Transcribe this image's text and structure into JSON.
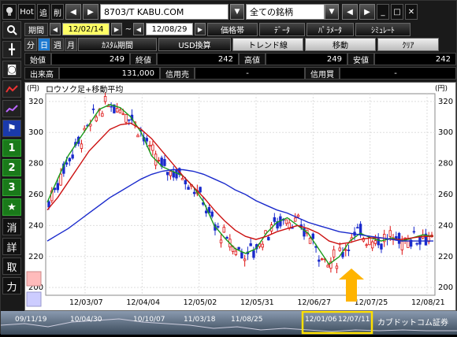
{
  "toolbar": {
    "hot": "Hot",
    "add": "追",
    "delete": "削",
    "symbol": "8703/T KABU.COM",
    "list": "全ての銘柄"
  },
  "period_row": {
    "label": "期間",
    "start": "12/02/14",
    "tilde": "~",
    "end": "12/08/29",
    "buttons": [
      "価格帯",
      "ﾃﾞｰﾀ",
      "ﾊﾟﾗﾒｰﾀ",
      "ｼﾐｭﾚｰﾄ"
    ]
  },
  "row2": {
    "periods": [
      "分",
      "日",
      "週",
      "月"
    ],
    "selected": "日",
    "buttons": [
      "ｶｽﾀﾑ期間",
      "USD換算",
      "トレンド線",
      "移動",
      "ｸﾘｱ"
    ]
  },
  "quote": {
    "open_label": "始値",
    "open": "249",
    "close_label": "終値",
    "close": "242",
    "high_label": "高値",
    "high": "249",
    "low_label": "安値",
    "low": "242",
    "volume_label": "出来高",
    "volume": "131,000",
    "margin_sell_label": "信用売",
    "margin_sell": "-",
    "margin_buy_label": "信用買",
    "margin_buy": "-"
  },
  "left_tools": [
    "1",
    "2",
    "3",
    "★",
    "消",
    "詳",
    "取",
    "力"
  ],
  "chart": {
    "unit_left": "(円)",
    "unit_right": "(円)",
    "title": "ロウソク足+移動平均",
    "y_ticks": [
      320,
      300,
      280,
      260,
      240,
      220,
      200
    ],
    "x_ticks": [
      "12/03/07",
      "12/04/04",
      "12/05/02",
      "12/05/31",
      "12/06/27",
      "12/07/25",
      "12/08/21"
    ]
  },
  "chart_data": {
    "type": "line",
    "ylim": [
      195,
      325
    ],
    "series": [
      {
        "values": [
          255,
          270,
          285,
          295,
          305,
          315,
          318,
          316,
          310,
          300,
          285,
          278,
          275,
          272,
          265,
          255,
          240,
          232,
          225,
          222,
          225,
          235,
          242,
          245,
          240,
          235,
          225,
          215,
          220,
          230,
          235,
          232,
          230,
          232,
          230,
          232,
          234,
          233
        ]
      },
      {
        "values": [
          250,
          258,
          268,
          278,
          288,
          295,
          302,
          305,
          306,
          302,
          296,
          288,
          280,
          272,
          265,
          258,
          250,
          243,
          237,
          233,
          231,
          233,
          236,
          238,
          240,
          238,
          235,
          230,
          228,
          229,
          231,
          232,
          232,
          231,
          231,
          232,
          233,
          233
        ]
      },
      {
        "values": [
          230,
          234,
          238,
          243,
          248,
          253,
          258,
          262,
          266,
          270,
          273,
          275,
          276,
          276,
          275,
          273,
          270,
          267,
          263,
          260,
          256,
          253,
          250,
          248,
          245,
          242,
          240,
          238,
          236,
          235,
          234,
          233,
          232,
          231,
          230,
          230,
          230,
          230
        ]
      }
    ],
    "series_colors": [
      "#1a9a1a",
      "#cc1111",
      "#1a2acc"
    ]
  },
  "bottom": {
    "dates": [
      "09/11/19",
      "10/04/30",
      "10/10/07",
      "11/03/18",
      "11/08/25",
      "12/01/06",
      "12/07/11"
    ],
    "brand": "カブドットコム証券"
  }
}
